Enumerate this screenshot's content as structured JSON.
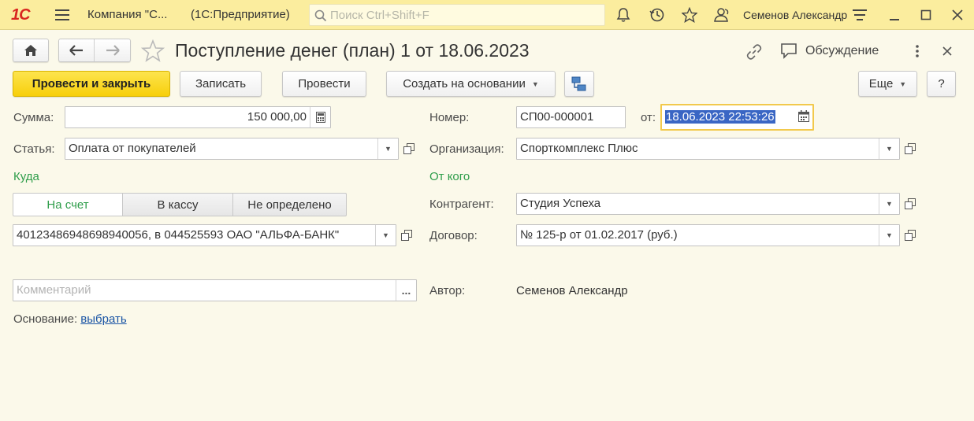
{
  "titlebar": {
    "logo": "1С",
    "company": "Компания \"С...",
    "app": "(1С:Предприятие)",
    "search_placeholder": "Поиск Ctrl+Shift+F",
    "user": "Семенов Александр"
  },
  "document": {
    "title": "Поступление денег (план) 1 от 18.06.2023",
    "discussion_label": "Обсуждение"
  },
  "toolbar": {
    "post_close": "Провести и закрыть",
    "save": "Записать",
    "post": "Провести",
    "create_based": "Создать на основании",
    "more": "Еще",
    "help": "?"
  },
  "form": {
    "sum_label": "Сумма:",
    "sum_value": "150 000,00",
    "article_label": "Статья:",
    "article_value": "Оплата от покупателей",
    "where_label": "Куда",
    "toggles": [
      "На счет",
      "В кассу",
      "Не определено"
    ],
    "account_value": "40123486948698940056, в 044525593 ОАО \"АЛЬФА-БАНК\"",
    "comment_placeholder": "Комментарий",
    "basis_label": "Основание:",
    "basis_link": "выбрать",
    "number_label": "Номер:",
    "number_value": "СП00-000001",
    "from_label": "от:",
    "date_value": "18.06.2023 22:53:26",
    "org_label": "Организация:",
    "org_value": "Спорткомплекс Плюс",
    "from_whom_label": "От кого",
    "counterparty_label": "Контрагент:",
    "counterparty_value": "Студия Успеха",
    "contract_label": "Договор:",
    "contract_value": "№ 125-р от 01.02.2017 (руб.)",
    "author_label": "Автор:",
    "author_value": "Семенов Александр"
  },
  "colors": {
    "titlebar_bg": "#fbed9e",
    "page_bg": "#fbf9ea",
    "primary_button": "#f7cf0b",
    "green_label": "#2e9d4a",
    "selection": "#3a66c4",
    "logo_red": "#d8261f"
  }
}
